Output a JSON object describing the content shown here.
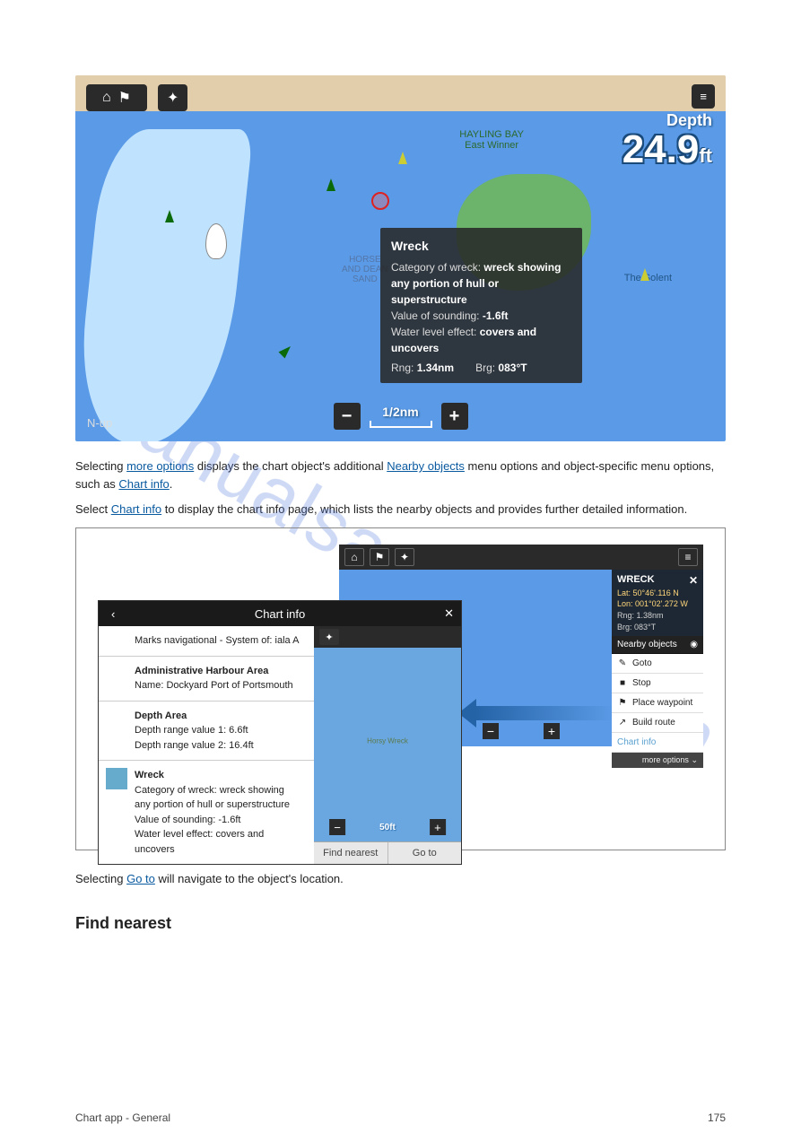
{
  "nav_screen": {
    "depth_label": "Depth",
    "depth_value": "24.9",
    "depth_unit": "ft",
    "scale_label": "1/2nm",
    "nup": "N-up",
    "label_horse": "HORSE\nAND DEAN\nSAND",
    "label_hayling": "HAYLING BAY\nEast Winner",
    "label_solent": "The Solent"
  },
  "popup": {
    "title": "Wreck",
    "cat_label": "Category of wreck:",
    "cat_value": "wreck showing any portion of hull or superstructure",
    "sounding_label": "Value of sounding:",
    "sounding_value": "-1.6ft",
    "level_label": "Water level effect:",
    "level_value": "covers and uncovers",
    "rng_label": "Rng:",
    "rng_value": "1.34nm",
    "brg_label": "Brg:",
    "brg_value": "083°T"
  },
  "para_full": {
    "p1a": "Selecting ",
    "p1_link1": "more options",
    "p1b": " displays the chart object's additional ",
    "p1_link2": "Nearby objects",
    "p1c": " menu options and object-specific menu options, such as ",
    "p1_link3": "Chart info",
    "p1_end": ".",
    "p2a": "Select ",
    "p2_link": "Chart info",
    "p2b": " to display the chart info page, which lists the nearby objects and provides further detailed information."
  },
  "chart_info_panel": {
    "title": "Chart info",
    "r1": "Marks navigational - System of: iala A",
    "r2h": "Administrative Harbour Area",
    "r2b": "Name: Dockyard Port of Portsmouth",
    "r3h": "Depth Area",
    "r3b1": "Depth range value 1: 6.6ft",
    "r3b2": "Depth range value 2: 16.4ft",
    "r4h": "Wreck",
    "r4b1": "Category of wreck: wreck showing any portion of hull or superstructure",
    "r4b2": "Value of sounding: -1.6ft",
    "r4b3": "Water level effect: covers and uncovers",
    "right_scale": "50ft",
    "right_mark": "Horsy Wreck",
    "btn_find": "Find nearest",
    "btn_goto": "Go to"
  },
  "mini_main": {
    "wreck_title": "WRECK",
    "lat": "Lat: 50°46'.116 N",
    "lon": "Lon: 001°02'.272 W",
    "rng": "Rng: 1.38nm",
    "brg": "Brg: 083°T",
    "nearby": "Nearby objects",
    "goto": "Goto",
    "stop": "Stop",
    "place": "Place waypoint",
    "build": "Build route",
    "info": "Chart info",
    "more": "more options"
  },
  "after_para": {
    "a": "Selecting ",
    "link": "Go to",
    "b": " will navigate to the object's location."
  },
  "section_heading": "Find nearest",
  "footer_left": "Chart app - General",
  "footer_right": "175",
  "watermark": "manualsarchive.com"
}
